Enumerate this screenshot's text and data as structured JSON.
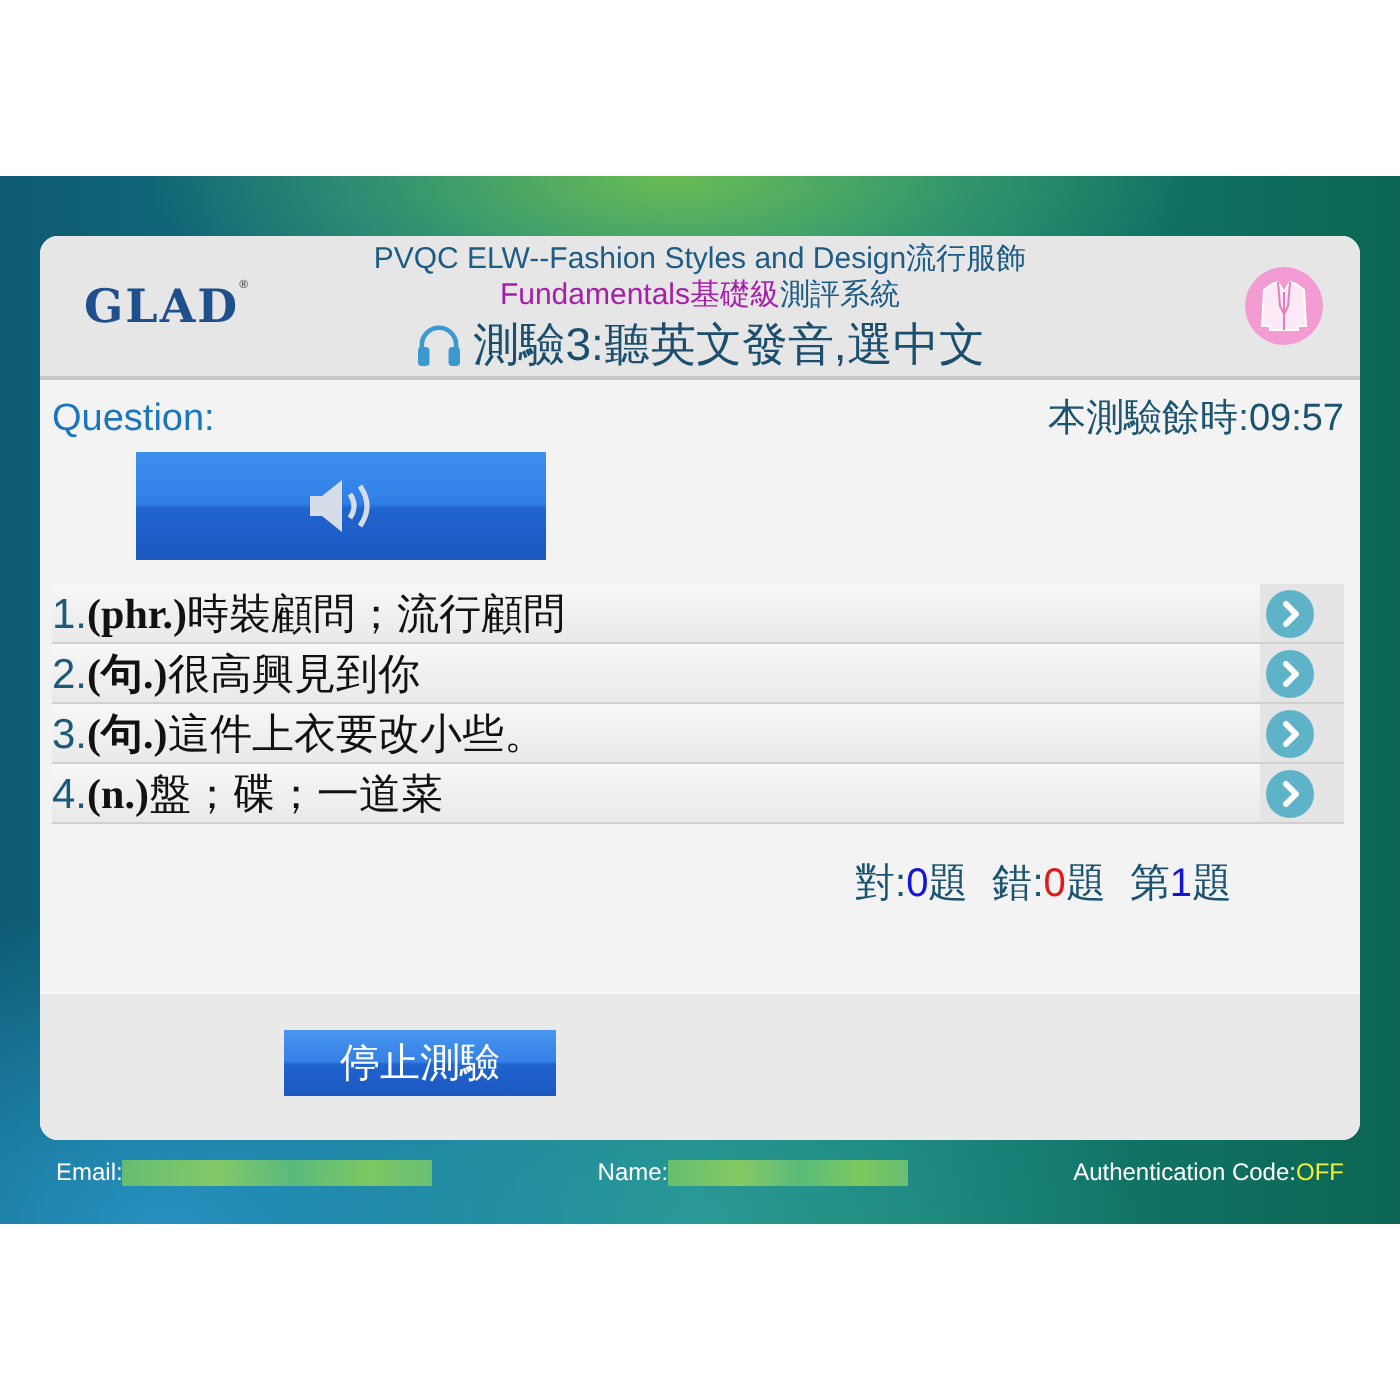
{
  "header": {
    "logo": {
      "text": "GLAD",
      "mark": "®"
    },
    "title": "PVQC ELW--Fashion Styles and Design流行服飾",
    "subtitle": [
      {
        "text": "Fundamentals基礎級",
        "kind": "highlight"
      },
      {
        "text": "測評系統",
        "kind": "plain"
      }
    ],
    "test_title": "測驗3:聽英文發音,選中文"
  },
  "question": {
    "label": "Question:",
    "timer": "本測驗餘時:09:57"
  },
  "options": [
    {
      "number": "1.",
      "text": "**(phr.)**時裝顧問；流行顧問"
    },
    {
      "number": "2.",
      "text": "**(句.)**很高興見到你"
    },
    {
      "number": "3.",
      "text": "**(句.)**這件上衣要改小些。"
    },
    {
      "number": "4.",
      "text": "**(n.)**盤；碟；一道菜"
    }
  ],
  "score": [
    {
      "label": "對:",
      "value": "0",
      "suffix": "題",
      "kind": "correct"
    },
    {
      "label": "錯:",
      "value": "0",
      "suffix": "題",
      "kind": "wrong"
    },
    {
      "label": "第",
      "value": "1",
      "suffix": "題",
      "kind": "current"
    }
  ],
  "stop_button": "停止測驗",
  "footer": {
    "email_label": "Email:",
    "name_label": "Name:",
    "auth_label": "Authentication Code:",
    "auth_value": "OFF"
  }
}
